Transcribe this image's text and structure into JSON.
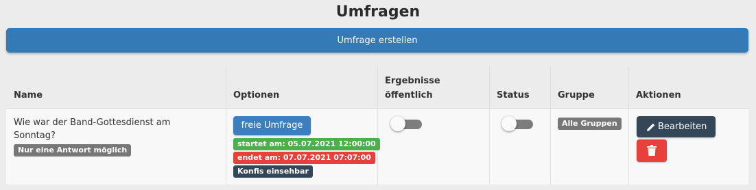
{
  "page": {
    "title": "Umfragen"
  },
  "toolbar": {
    "create_label": "Umfrage erstellen"
  },
  "table": {
    "headers": {
      "name": "Name",
      "options": "Optionen",
      "results_public_line1": "Ergebnisse",
      "results_public_line2": "öffentlich",
      "status": "Status",
      "group": "Gruppe",
      "actions": "Aktionen"
    },
    "rows": [
      {
        "name_line1": "Wie war der Band-Gottesdienst am",
        "name_line2": "Sonntag?",
        "answer_mode": "Nur eine Antwort möglich",
        "type_button": "freie Umfrage",
        "start": "startet am: 05.07.2021 12:00:00",
        "end": "endet am: 07.07.2021 07:07:00",
        "visibility": "Konfis einsehbar",
        "results_public": false,
        "status_active": false,
        "group": "Alle Gruppen",
        "edit_label": "Bearbeiten",
        "edit_icon": "pencil-icon",
        "delete_icon": "trash-icon"
      }
    ]
  },
  "colors": {
    "primary": "#337ab7",
    "badge_gray": "#777777",
    "badge_green": "#4cae4c",
    "badge_red": "#e8413b",
    "badge_dark": "#344759"
  }
}
